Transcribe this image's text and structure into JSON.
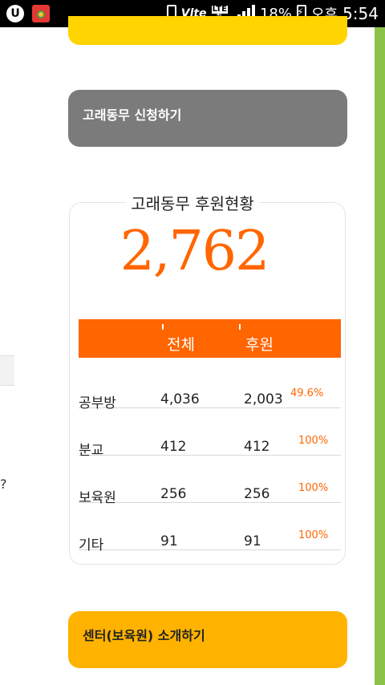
{
  "status_bar": {
    "u_label": "U",
    "volte": "Vlte",
    "lte": "LTE",
    "battery": "18%",
    "ampm": "오후",
    "time": "5:54"
  },
  "left_clip": {
    "text": "?"
  },
  "apply_button": {
    "label": "고래동무  신청하기"
  },
  "status_card": {
    "title": "고래동무 후원현황",
    "total": "2,762",
    "headers": {
      "total": "전체",
      "support": "후원"
    },
    "rows": [
      {
        "name": "공부방",
        "total": "4,036",
        "support": "2,003",
        "percent": "49.6%"
      },
      {
        "name": "분교",
        "total": "412",
        "support": "412",
        "percent": "100%"
      },
      {
        "name": "보육원",
        "total": "256",
        "support": "256",
        "percent": "100%"
      },
      {
        "name": "기타",
        "total": "91",
        "support": "91",
        "percent": "100%"
      }
    ]
  },
  "intro_button": {
    "label": "센터(보육원) 소개하기"
  },
  "colors": {
    "accent": "#ff6600",
    "gray_button": "#7b7b7b",
    "yellow": "#ffd400",
    "orange_button": "#ffb300",
    "scroll_green": "#8bc34a"
  }
}
